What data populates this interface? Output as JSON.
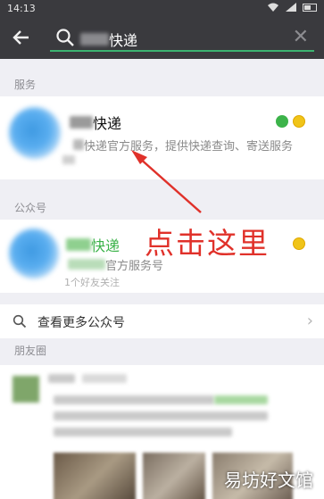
{
  "status_bar": {
    "time": "14:13"
  },
  "search": {
    "query_suffix": "快递"
  },
  "sections": {
    "services": "服务",
    "official_accounts": "公众号",
    "moments": "朋友圈"
  },
  "service_result": {
    "title_suffix": "快递",
    "description": "快递官方服务，提供快递查询、寄送服务"
  },
  "account_result": {
    "title_suffix": "快递",
    "description": "官方服务号",
    "followers": "1个好友关注"
  },
  "more_accounts": {
    "label": "查看更多公众号"
  },
  "annotation": {
    "text": "点击这里",
    "color": "#e0312a"
  },
  "watermark": {
    "text": "易坊好文馆"
  },
  "colors": {
    "accent_green": "#3cb371",
    "header_bg": "#3a3a3e"
  }
}
